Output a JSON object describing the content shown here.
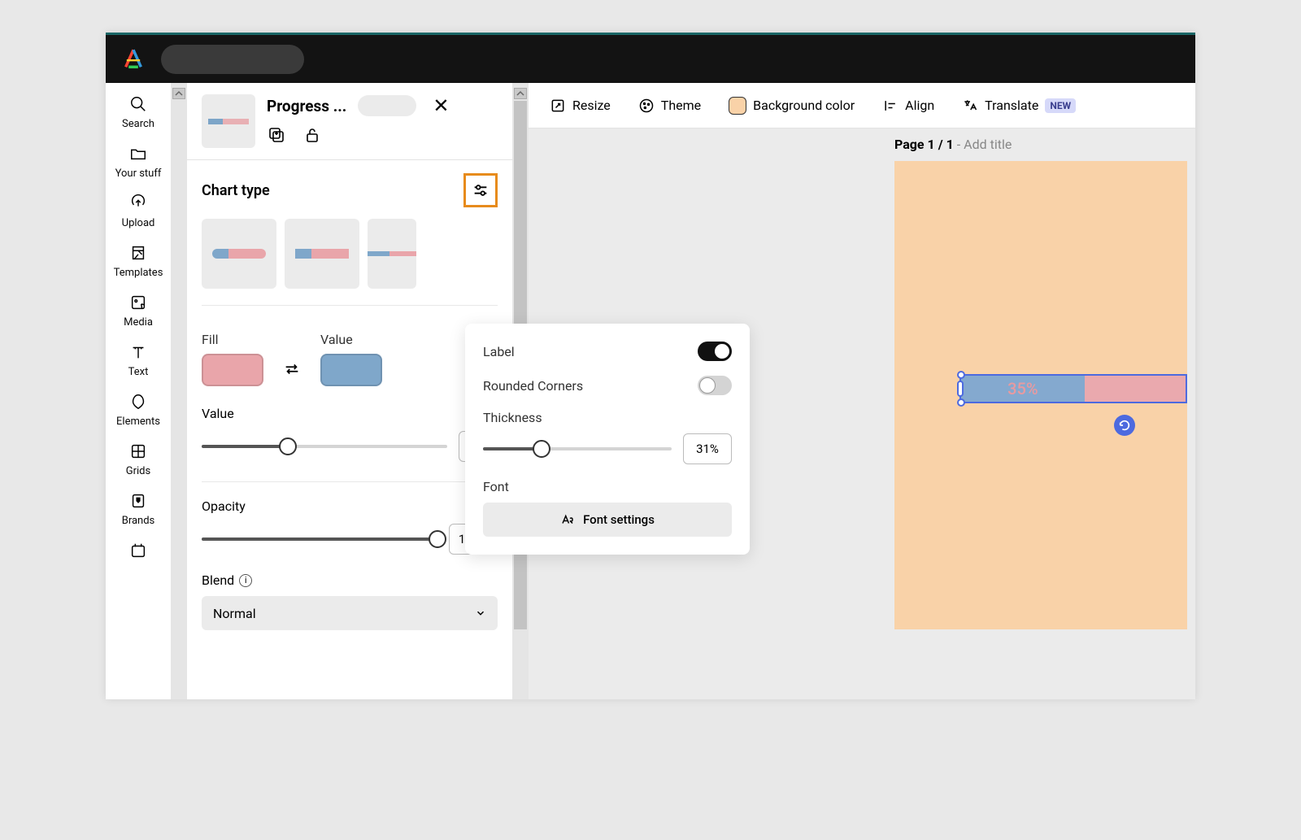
{
  "leftRail": {
    "search": "Search",
    "yourStuff": "Your stuff",
    "upload": "Upload",
    "templates": "Templates",
    "media": "Media",
    "text": "Text",
    "elements": "Elements",
    "grids": "Grids",
    "brands": "Brands"
  },
  "panel": {
    "title": "Progress ...",
    "chartTypeTitle": "Chart type",
    "fillLabel": "Fill",
    "valueLabel": "Value",
    "valueSliderLabel": "Value",
    "opacityLabel": "Opacity",
    "opacityValue": "100%",
    "blendLabel": "Blend",
    "blendValue": "Normal"
  },
  "popover": {
    "label": "Label",
    "roundedCorners": "Rounded Corners",
    "thickness": "Thickness",
    "thicknessValue": "31%",
    "font": "Font",
    "fontSettings": "Font settings"
  },
  "toolbar": {
    "resize": "Resize",
    "theme": "Theme",
    "backgroundColor": "Background color",
    "align": "Align",
    "translate": "Translate",
    "newBadge": "NEW"
  },
  "canvas": {
    "pageNum": "Page 1 / 1",
    "addTitle": " - Add title",
    "progressText": "35%"
  },
  "chart_data": {
    "type": "bar",
    "title": "Progress",
    "categories": [
      "progress"
    ],
    "values": [
      35
    ],
    "xlabel": "",
    "ylabel": "",
    "ylim": [
      0,
      100
    ]
  }
}
